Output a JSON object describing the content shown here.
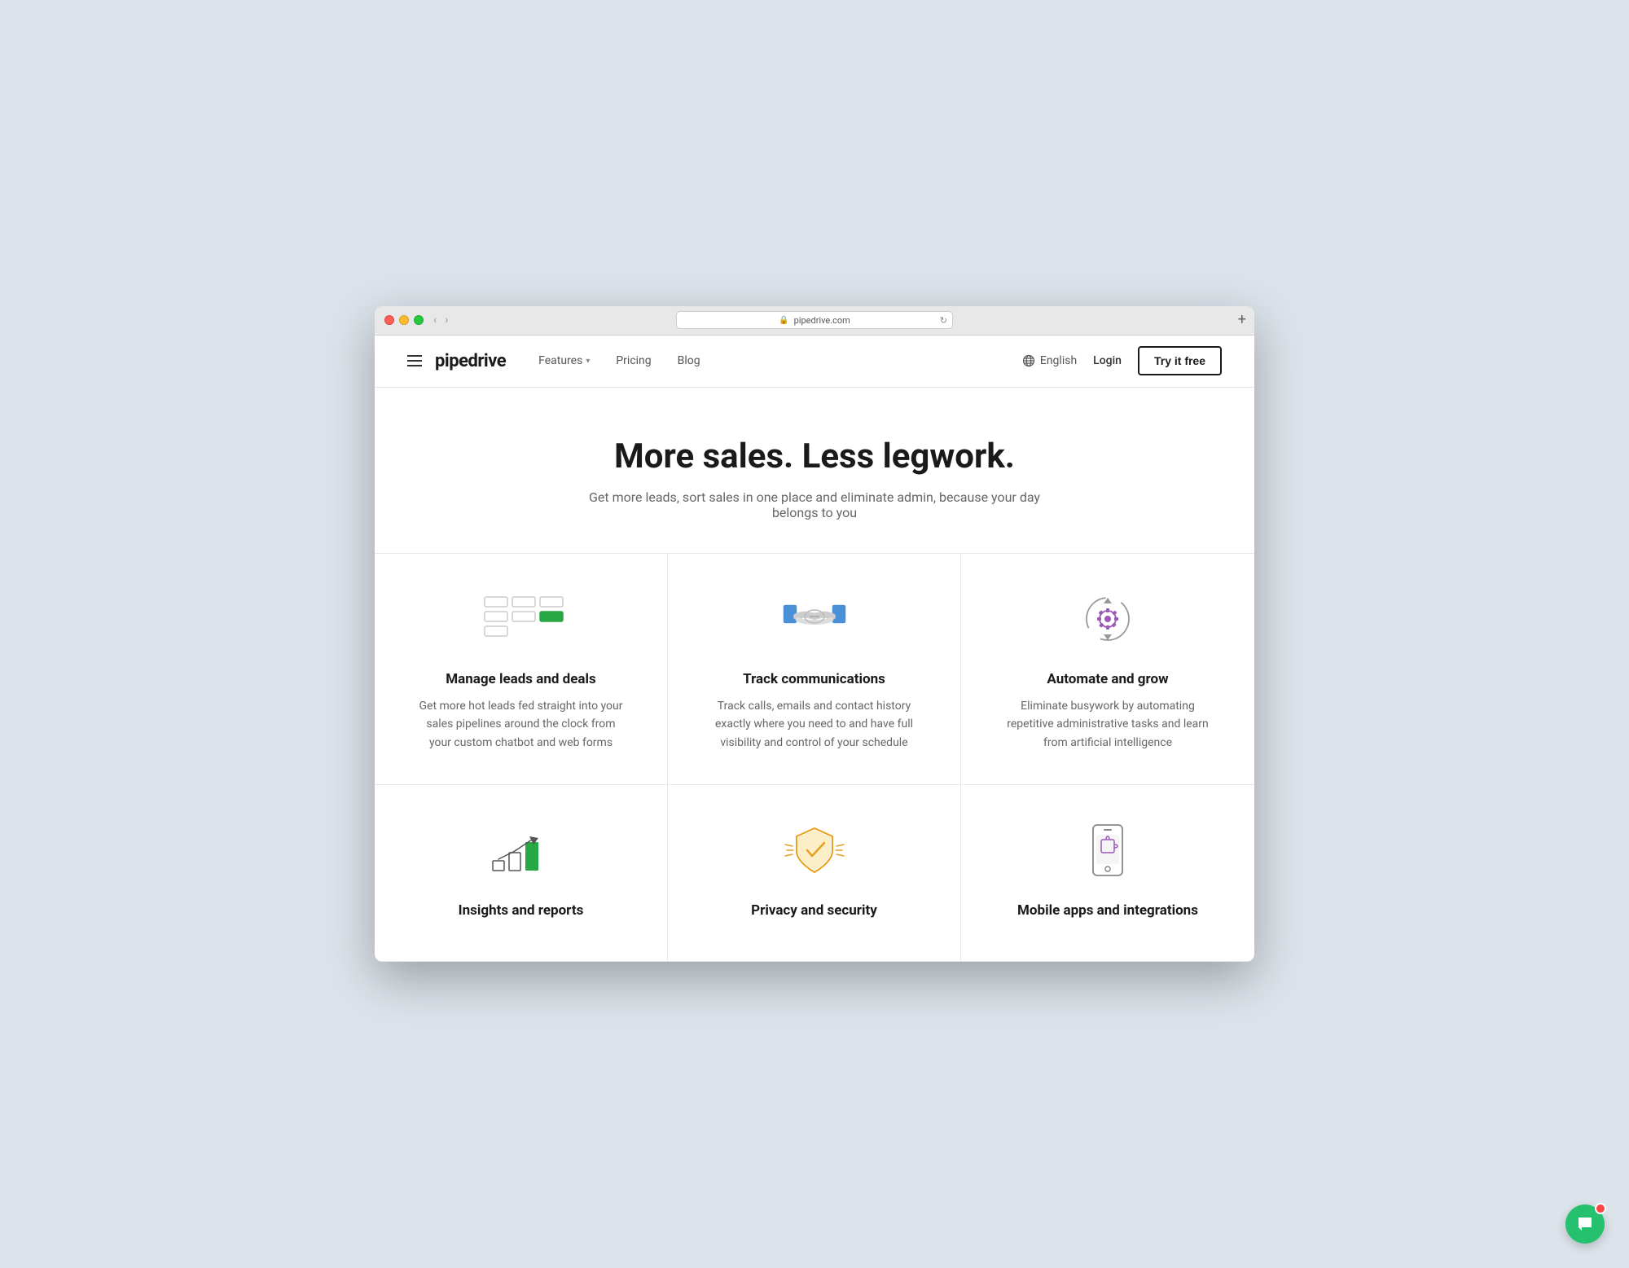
{
  "window": {
    "url": "pipedrive.com",
    "traffic_lights": [
      "red",
      "yellow",
      "green"
    ]
  },
  "nav": {
    "logo": "pipedrive",
    "features_label": "Features",
    "pricing_label": "Pricing",
    "blog_label": "Blog",
    "language_label": "English",
    "login_label": "Login",
    "try_label": "Try it free"
  },
  "hero": {
    "title": "More sales. Less legwork.",
    "subtitle": "Get more leads, sort sales in one place and eliminate admin, because your day belongs to you"
  },
  "features": [
    {
      "id": "manage-leads",
      "title": "Manage leads and deals",
      "description": "Get more hot leads fed straight into your sales pipelines around the clock from your custom chatbot and web forms"
    },
    {
      "id": "track-communications",
      "title": "Track communications",
      "description": "Track calls, emails and contact history exactly where you need to and have full visibility and control of your schedule"
    },
    {
      "id": "automate-grow",
      "title": "Automate and grow",
      "description": "Eliminate busywork by automating repetitive administrative tasks and learn from artificial intelligence"
    },
    {
      "id": "insights-reports",
      "title": "Insights and reports",
      "description": ""
    },
    {
      "id": "privacy-security",
      "title": "Privacy and security",
      "description": ""
    },
    {
      "id": "mobile-apps",
      "title": "Mobile apps and integrations",
      "description": ""
    }
  ]
}
